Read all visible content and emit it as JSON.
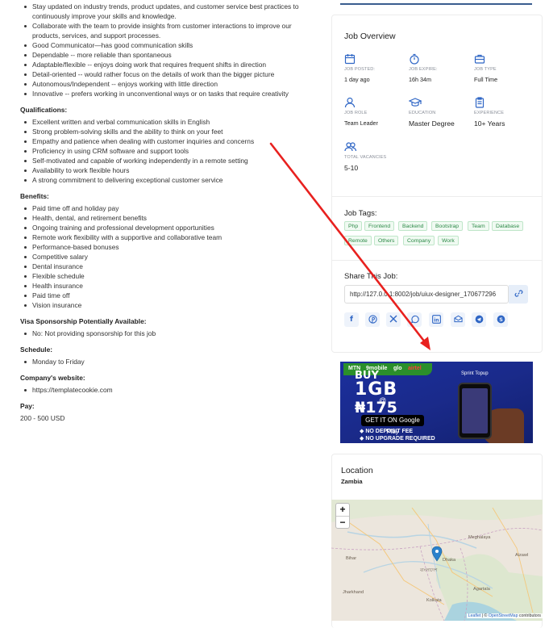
{
  "responsibilities_tail": [
    "Stay updated on industry trends, product updates, and customer service best practices to continuously improve your skills and knowledge.",
    "Collaborate with the team to provide insights from customer interactions to improve our products, services, and support processes.",
    "Good Communicator—has good communication skills",
    "Dependable -- more reliable than spontaneous",
    "Adaptable/flexible -- enjoys doing work that requires frequent shifts in direction",
    "Detail-oriented -- would rather focus on the details of work than the bigger picture",
    "Autonomous/Independent -- enjoys working with little direction",
    "Innovative -- prefers working in unconventional ways or on tasks that require creativity"
  ],
  "qualifications": {
    "heading": "Qualifications:",
    "items": [
      "Excellent written and verbal communication skills in English",
      "Strong problem-solving skills and the ability to think on your feet",
      "Empathy and patience when dealing with customer inquiries and concerns",
      "Proficiency in using CRM software and support tools",
      "Self-motivated and capable of working independently in a remote setting",
      "Availability to work flexible hours",
      "A strong commitment to delivering exceptional customer service"
    ]
  },
  "benefits": {
    "heading": "Benefits:",
    "items": [
      "Paid time off and holiday pay",
      "Health, dental, and retirement benefits",
      "Ongoing training and professional development opportunities",
      "Remote work flexibility with a supportive and collaborative team",
      "Performance-based bonuses",
      "Competitive salary",
      "Dental insurance",
      "Flexible schedule",
      "Health insurance",
      "Paid time off",
      "Vision insurance"
    ]
  },
  "visa": {
    "heading": "Visa Sponsorship Potentially Available:",
    "items": [
      "No: Not providing sponsorship for this job"
    ]
  },
  "schedule": {
    "heading": "Schedule:",
    "items": [
      "Monday to Friday"
    ]
  },
  "website": {
    "heading": "Company's website:",
    "items": [
      "https://templatecookie.com"
    ]
  },
  "pay": {
    "heading": "Pay:",
    "value": "200 - 500 USD"
  },
  "overview": {
    "title": "Job Overview",
    "items": [
      {
        "icon": "calendar-icon",
        "label": "JOB POSTED:",
        "value": "1 day ago"
      },
      {
        "icon": "stopwatch-icon",
        "label": "JOB EXPIRE:",
        "value": "16h 34m"
      },
      {
        "icon": "briefcase-icon",
        "label": "JOB TYPE",
        "value": "Full Time"
      },
      {
        "icon": "user-icon",
        "label": "JOB ROLE",
        "value": "Team Leader"
      },
      {
        "icon": "graduation-cap-icon",
        "label": "EDUCATION",
        "value": "Master Degree"
      },
      {
        "icon": "clipboard-icon",
        "label": "EXPERIENCE",
        "value": "10+ Years"
      },
      {
        "icon": "users-icon",
        "label": "TOTAL VACANCIES",
        "value": "5-10"
      }
    ]
  },
  "tags": {
    "title": "Job Tags:",
    "items": [
      "Php",
      "Frontend",
      "Backend",
      "Bootstrap",
      "Team",
      "Database",
      "Remote",
      "Others",
      "Company",
      "Work"
    ]
  },
  "share": {
    "title": "Share This Job:",
    "url": "http://127.0.0.1:8002/job/uiux-designer_170677296",
    "socials": [
      "facebook-icon",
      "pinterest-icon",
      "x-twitter-icon",
      "whatsapp-icon",
      "linkedin-icon",
      "email-icon",
      "telegram-icon",
      "skype-icon"
    ]
  },
  "ad": {
    "topbar": [
      "MTN",
      "9mobile",
      "glo",
      "airtel"
    ],
    "brand": "Sprint Topup",
    "line1": "BUY",
    "line2": "1GB",
    "line3": "@",
    "line4": "₦175",
    "store": "GET IT ON Google Play",
    "note1": "◆ NO DEPOSIT FEE",
    "note2": "◆ NO UPGRADE REQUIRED"
  },
  "location": {
    "title": "Location",
    "value": "Zambia",
    "zoom_in": "+",
    "zoom_out": "−",
    "attribution_leaflet": "Leaflet",
    "attribution_sep": " | © ",
    "attribution_osm": "OpenStreetMap",
    "attribution_tail": " contributors",
    "labels": [
      "Bihar",
      "Dhaka",
      "Kolkata",
      "Agartala",
      "Jharkhand",
      "Aizawl",
      "বাংলাদেশ",
      "Meghalaya"
    ]
  },
  "colors": {
    "accent": "#2f66c5",
    "tag_green": "#2c8a47",
    "arrow": "#e8211f"
  }
}
